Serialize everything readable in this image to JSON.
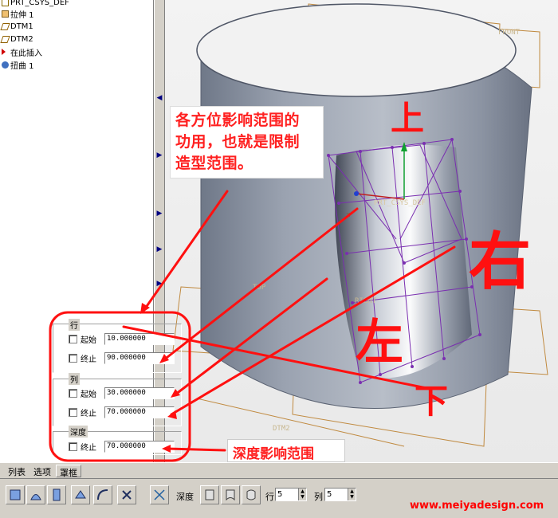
{
  "model_tree": {
    "items": [
      {
        "label": "PRT_CSYS_DEF"
      },
      {
        "label": "拉伸 1"
      },
      {
        "label": "DTM1"
      },
      {
        "label": "DTM2"
      },
      {
        "label": "在此插入"
      },
      {
        "label": "扭曲 1"
      }
    ]
  },
  "viewport": {
    "datum_labels": {
      "front": "FRONT",
      "top": "TOP",
      "right": "RIGHT",
      "dtm2": "DTM2",
      "csys": "PRT_CSYS_DEF",
      "x_mark": "x"
    }
  },
  "annotations": {
    "callout_lines": [
      "各方位影响范围的",
      "功用，也就是限制",
      "造型范围。"
    ],
    "depth_note": "深度影响范围",
    "handwritten": {
      "up": "上",
      "down": "下",
      "left": "左",
      "right": "右"
    }
  },
  "region_panel": {
    "row_group": {
      "title": "行",
      "start": {
        "label": "起始",
        "value": "10.000000"
      },
      "end": {
        "label": "终止",
        "value": "90.000000"
      }
    },
    "col_group": {
      "title": "列",
      "start": {
        "label": "起始",
        "value": "30.000000"
      },
      "end": {
        "label": "终止",
        "value": "70.000000"
      }
    },
    "depth_group": {
      "title": "深度",
      "end": {
        "label": "终止",
        "value": "70.000000"
      }
    }
  },
  "tabs": [
    {
      "label": "列表"
    },
    {
      "label": "选项"
    },
    {
      "label": "罩框"
    }
  ],
  "toolbar": {
    "depth_label": "深度",
    "row_label": "行",
    "row_value": "5",
    "col_label": "列",
    "col_value": "5"
  },
  "watermark": "www.meiyadesign.com",
  "colors": {
    "annotation_red": "#ff2020",
    "lattice_purple": "#7a2fb0",
    "cylinder": "#8f98a8"
  }
}
